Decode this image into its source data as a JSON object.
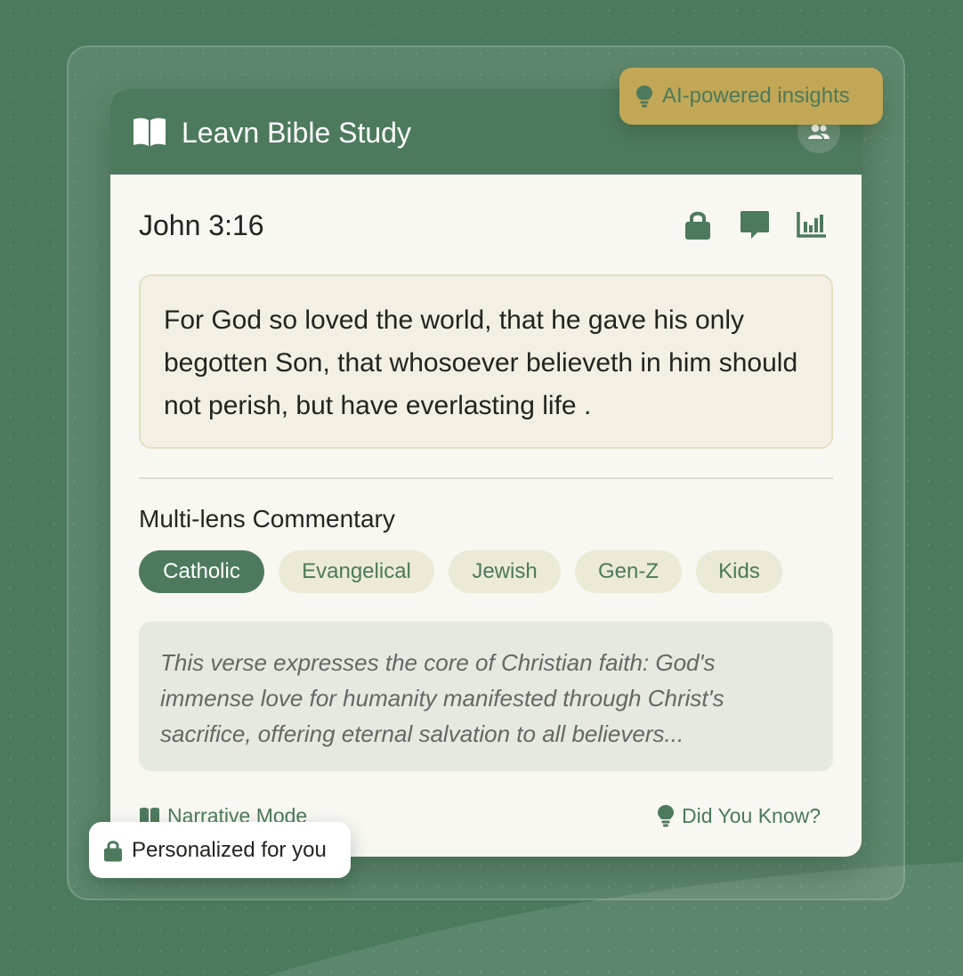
{
  "colors": {
    "brand_green": "#4d7a5d",
    "gold": "#c2a756",
    "card_bg": "#f8f7f2",
    "verse_bg": "#f3f0e3",
    "chip_bg": "#ecead6"
  },
  "app": {
    "title": "Leavn Bible Study",
    "logo_icon": "open-book-icon",
    "header_action_icon": "users-icon"
  },
  "verse": {
    "reference": "John 3:16",
    "text": " For God  so loved the world, that he gave his only begotten Son, that whosoever believeth in him should not perish, but have  everlasting life .",
    "tools": [
      {
        "name": "lock-icon"
      },
      {
        "name": "comment-icon"
      },
      {
        "name": "chart-icon"
      }
    ]
  },
  "commentary": {
    "title": "Multi-lens Commentary",
    "lenses": [
      {
        "label": "Catholic",
        "active": true
      },
      {
        "label": "Evangelical",
        "active": false
      },
      {
        "label": "Jewish",
        "active": false
      },
      {
        "label": "Gen-Z",
        "active": false
      },
      {
        "label": "Kids",
        "active": false
      }
    ],
    "text": "This verse expresses the core of Christian faith: God's immense love for humanity manifested through Christ's sacrifice, offering eternal salvation to all believers..."
  },
  "footer": {
    "narrative_label": "Narrative Mode",
    "did_you_know_label": "Did You Know?"
  },
  "badges": {
    "ai_label": "AI-powered insights",
    "personalized_label": "Personalized for you"
  }
}
